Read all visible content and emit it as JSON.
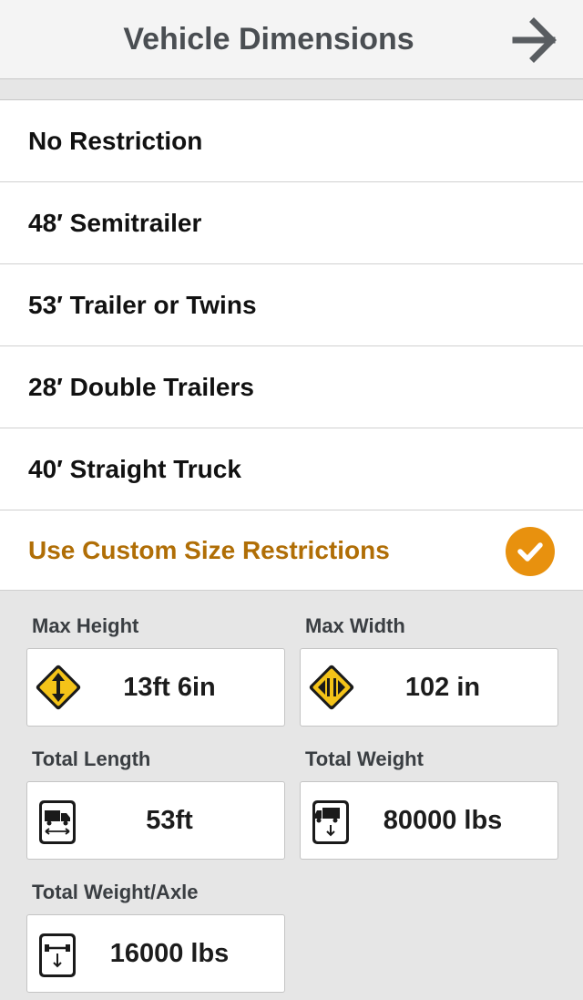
{
  "header": {
    "title": "Vehicle Dimensions",
    "next_icon": "arrow-right-icon"
  },
  "presets": [
    {
      "label": "No Restriction"
    },
    {
      "label": "48′ Semitrailer"
    },
    {
      "label": "53′ Trailer or Twins"
    },
    {
      "label": "28′ Double Trailers"
    },
    {
      "label": "40′ Straight Truck"
    }
  ],
  "custom": {
    "label": "Use Custom Size Restrictions",
    "selected": true,
    "check_icon": "checkmark-circle-icon",
    "accent": "#e8910e",
    "text_color": "#b06e06"
  },
  "fields": {
    "max_height": {
      "label": "Max Height",
      "value": "13ft 6in",
      "icon": "height-warning-sign-icon"
    },
    "max_width": {
      "label": "Max Width",
      "value": "102 in",
      "icon": "width-warning-sign-icon"
    },
    "total_length": {
      "label": "Total Length",
      "value": "53ft",
      "icon": "truck-length-icon"
    },
    "total_weight": {
      "label": "Total Weight",
      "value": "80000 lbs",
      "icon": "truck-weight-icon"
    },
    "weight_per_axle": {
      "label": "Total Weight/Axle",
      "value": "16000 lbs",
      "icon": "axle-weight-icon"
    }
  }
}
